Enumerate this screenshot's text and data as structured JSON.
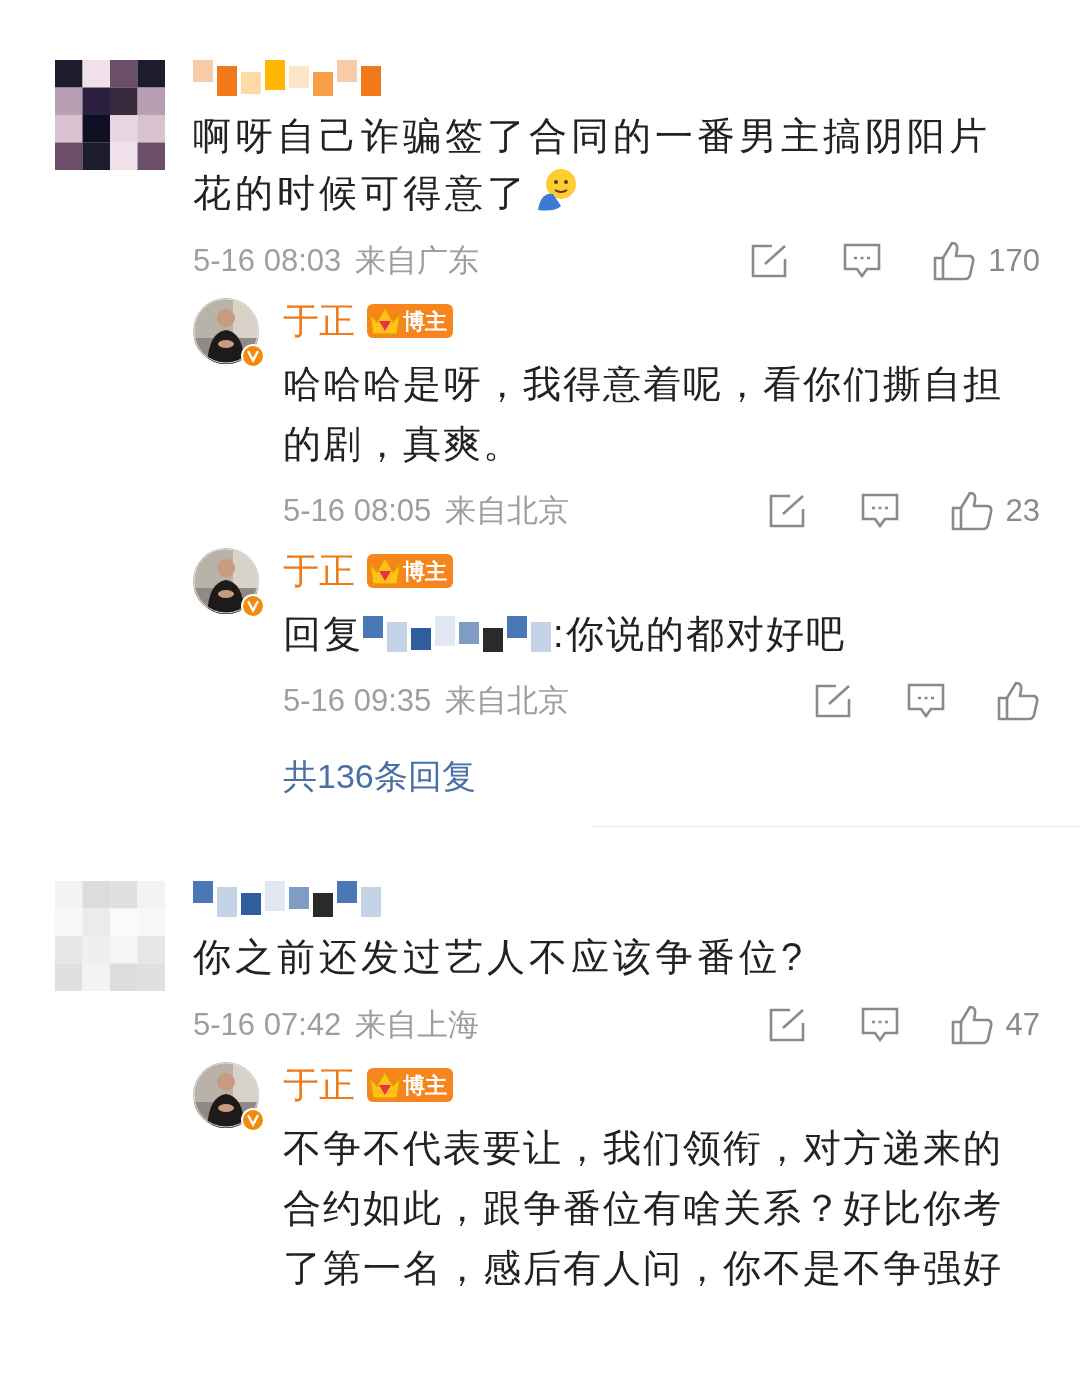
{
  "comments": [
    {
      "kind": "dark",
      "text": "啊呀自己诈骗签了合同的一番男主搞阴阳片花的时候可得意了",
      "trailing_emoji": true,
      "time": "5-16 08:03",
      "location": "来自广东",
      "likes": "170",
      "replies": [
        {
          "name": "于正",
          "badge": "博主",
          "text": "哈哈哈是呀，我得意着呢，看你们撕自担的剧，真爽。",
          "time": "5-16 08:05",
          "location": "来自北京",
          "likes": "23"
        },
        {
          "name": "于正",
          "badge": "博主",
          "reply_prefix": "回复",
          "text": ":你说的都对好吧",
          "time": "5-16 09:35",
          "location": "来自北京"
        }
      ],
      "more_replies": "共136条回复"
    },
    {
      "kind": "light",
      "text": "你之前还发过艺人不应该争番位?",
      "trailing_emoji": false,
      "time": "5-16 07:42",
      "location": "来自上海",
      "likes": "47",
      "replies": [
        {
          "name": "于正",
          "badge": "博主",
          "text": "不争不代表要让，我们领衔，对方递来的合约如此，跟争番位有啥关系？好比你考了第一名，感后有人问，你不是不争强好"
        }
      ]
    }
  ]
}
